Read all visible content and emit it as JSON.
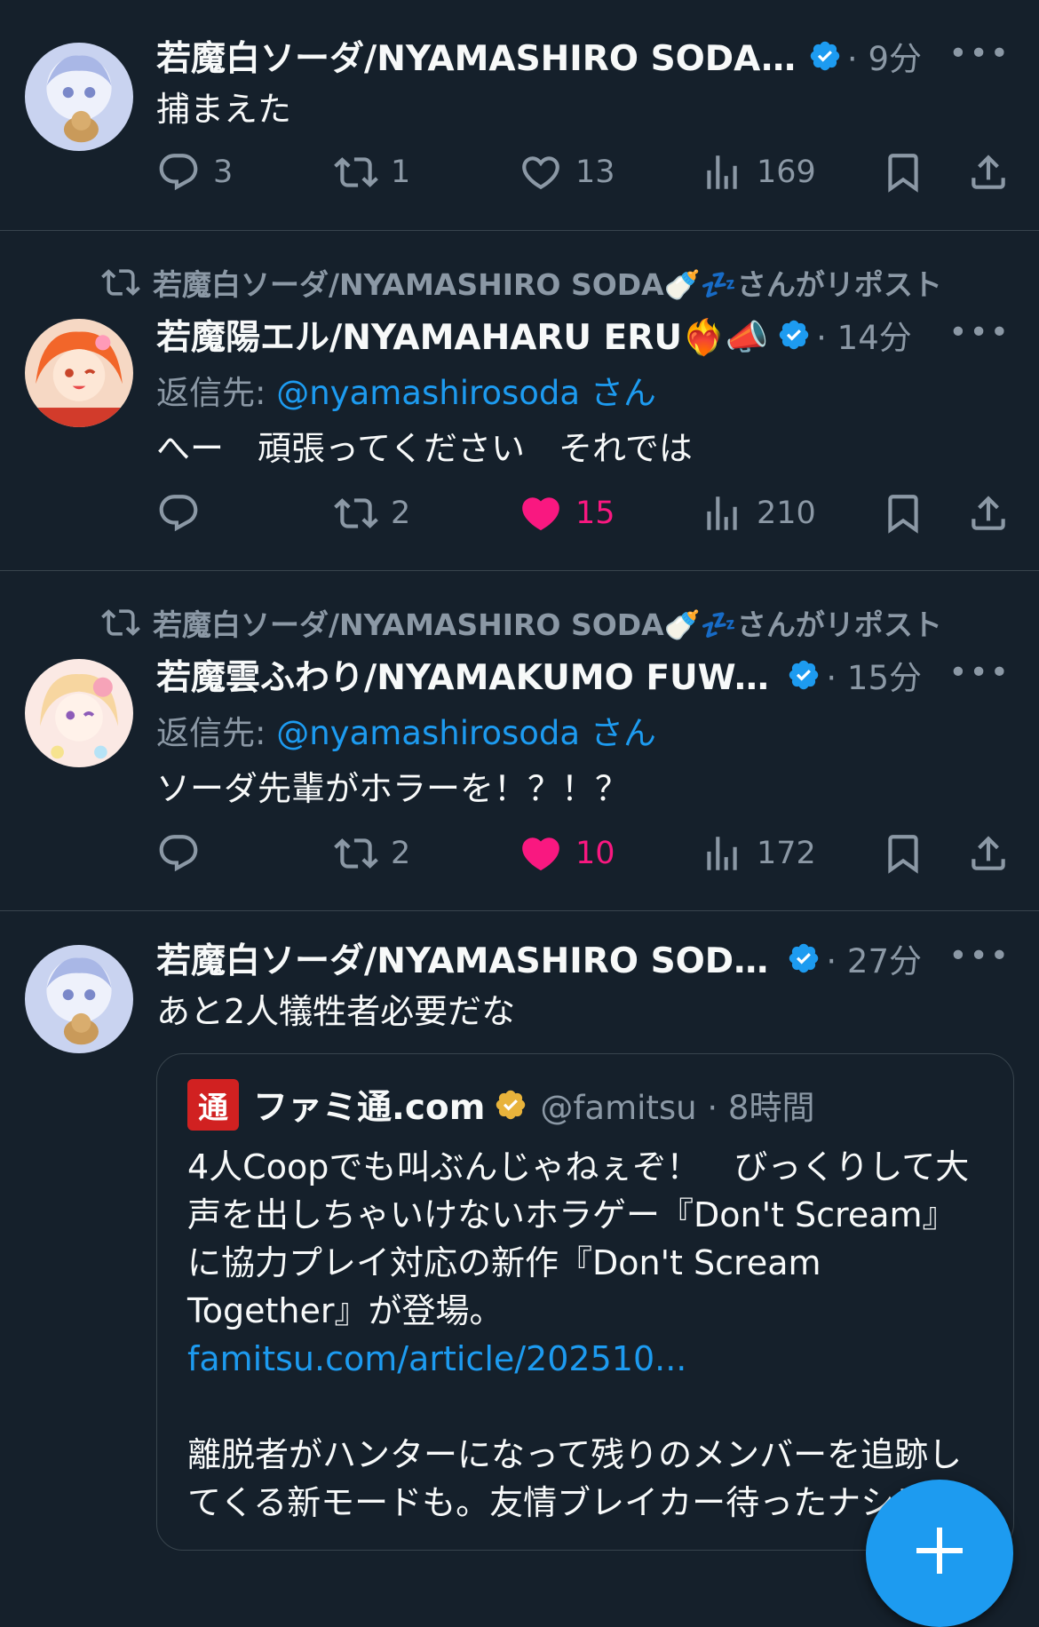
{
  "timeline": {
    "tweets": [
      {
        "author_name": "若魔白ソーダ/NYAMASHIRO SODA...",
        "time": "· 9分",
        "text": "捕まえた",
        "stats": {
          "replies": "3",
          "reposts": "1",
          "likes": "13",
          "views": "169"
        },
        "liked": false
      },
      {
        "repost_label": "若魔白ソーダ/NYAMASHIRO SODA🍼💤さんがリポスト",
        "author_name": "若魔陽エル/NYAMAHARU ERU❤️‍🔥📣",
        "time": "· 14分",
        "reply_prefix": "返信先: ",
        "reply_handle": "@nyamashirosoda さん",
        "text": "へー　頑張ってください　それでは",
        "stats": {
          "replies": "",
          "reposts": "2",
          "likes": "15",
          "views": "210"
        },
        "liked": true
      },
      {
        "repost_label": "若魔白ソーダ/NYAMASHIRO SODA🍼💤さんがリポスト",
        "author_name": "若魔雲ふわり/NYAMAKUMO FUWA...",
        "time": "· 15分",
        "reply_prefix": "返信先: ",
        "reply_handle": "@nyamashirosoda さん",
        "text": "ソーダ先輩がホラーを！？！？",
        "stats": {
          "replies": "",
          "reposts": "2",
          "likes": "10",
          "views": "172"
        },
        "liked": true
      },
      {
        "author_name": "若魔白ソーダ/NYAMASHIRO SODA...",
        "time": "· 27分",
        "text": "あと2人犠牲者必要だな",
        "quote": {
          "logo_char": "通",
          "name": "ファミ通.com",
          "handle_time": "@famitsu · 8時間",
          "text": "4人Coopでも叫ぶんじゃねぇぞ！　びっくりして大声を出しちゃいけないホラゲー『Don't Scream』に協力プレイ対応の新作『Don't Scream Together』が登場。",
          "link": "famitsu.com/article/202510...",
          "text2": "離脱者がハンターになって残りのメンバーを追跡してくる新モードも。友情ブレイカー待ったナシ！"
        }
      }
    ]
  },
  "more_label": "•••",
  "fab": {
    "icon": "plus-icon"
  },
  "colors": {
    "background": "#15202b",
    "accent": "#1d9bf0",
    "like": "#f91880",
    "muted": "#8b98a5",
    "gold": "#e8b33b"
  }
}
